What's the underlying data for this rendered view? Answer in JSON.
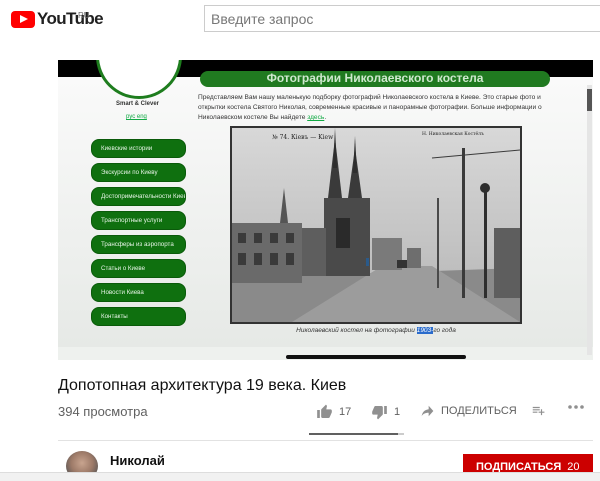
{
  "header": {
    "logo_text": "YouTube",
    "region": "RU",
    "search_placeholder": "Введите запрос"
  },
  "player": {
    "site": {
      "slogan": "Smart & Clever",
      "lang": "рус eng",
      "banner": "Фотографии Николаевского костела",
      "intro": "Представляем Вам нашу маленькую подборку фотографий Николаевского костела в Киеве. Это старые фото и открытки костела Святого Николая, современные красивые и панорамные фотографии. Больше информации о Николаевском костеле Вы найдете ",
      "intro_link": "здесь",
      "menu": [
        "Киевские истории",
        "Экскурсии по Киеву",
        "Достопримечательности Киева",
        "Транспортные услуги",
        "Трансферы из аэропорта",
        "Статьи о Киеве",
        "Новости Киева",
        "Контакты"
      ],
      "photo_label_left": "№ 74. Кiевъ — Kiew",
      "photo_label_right": "Н. Николаевская Костёлъ",
      "caption_before": "Николаевский костел на фотографии ",
      "caption_highlight": "1903-",
      "caption_after": "го года"
    }
  },
  "video": {
    "title": "Допотопная архитектура 19 века. Киев",
    "views": "394 просмотра",
    "likes": "17",
    "dislikes": "1",
    "share_label": "ПОДЕЛИТЬСЯ",
    "like_ratio": 0.94
  },
  "channel": {
    "name": "Николай",
    "subscribe_label": "ПОДПИСАТЬСЯ",
    "subscriber_count": "20"
  },
  "colors": {
    "brand_red": "#ff0000",
    "subscribe_red": "#cc0000",
    "site_green": "#0f700f"
  }
}
